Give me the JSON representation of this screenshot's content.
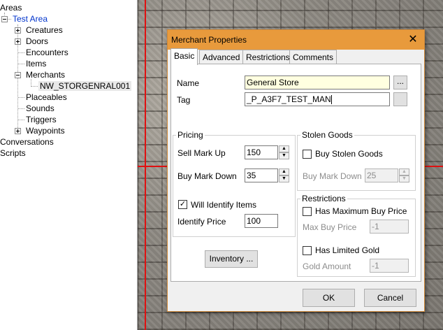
{
  "tree": {
    "root": "Areas",
    "area": "Test Area",
    "children": [
      "Creatures",
      "Doors",
      "Encounters",
      "Items",
      "Merchants",
      "Placeables",
      "Sounds",
      "Triggers",
      "Waypoints"
    ],
    "merchant_item": "NW_STORGENRAL001",
    "conversations": "Conversations",
    "scripts": "Scripts"
  },
  "dialog": {
    "title": "Merchant Properties",
    "close": "✕",
    "tabs": [
      "Basic",
      "Advanced",
      "Restrictions",
      "Comments"
    ],
    "name_label": "Name",
    "name_value": "General Store",
    "tag_label": "Tag",
    "tag_value": "_P_A3F7_TEST_MAN",
    "ellipsis": "...",
    "pricing": {
      "title": "Pricing",
      "sell_label": "Sell Mark Up",
      "sell_value": "150",
      "buy_label": "Buy Mark Down",
      "buy_value": "35",
      "identify_label": "Will Identify Items",
      "identify_price_label": "Identify Price",
      "identify_price_value": "100"
    },
    "stolen": {
      "title": "Stolen Goods",
      "buy_stolen_label": "Buy Stolen Goods",
      "buy_markdown_label": "Buy Mark Down",
      "buy_markdown_value": "25"
    },
    "restrictions": {
      "title": "Restrictions",
      "max_buy_label": "Has Maximum Buy Price",
      "max_buy_price_label": "Max Buy Price",
      "max_buy_price_value": "-1",
      "limited_gold_label": "Has Limited Gold",
      "gold_amount_label": "Gold Amount",
      "gold_amount_value": "-1"
    },
    "inventory_button": "Inventory ...",
    "ok": "OK",
    "cancel": "Cancel"
  },
  "colors": {
    "titlebar": "#e89a3c",
    "name_field_bg": "#ffffe0",
    "selected_tree_text": "#0033cc",
    "grid_line": "#e01010"
  }
}
